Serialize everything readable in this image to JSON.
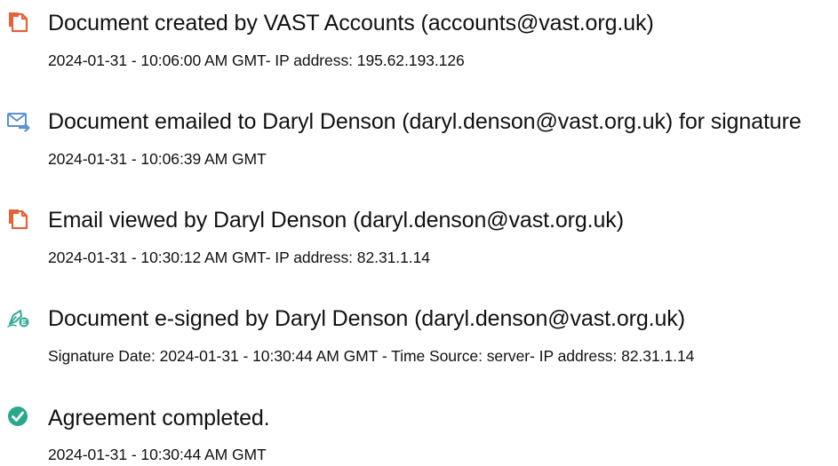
{
  "colors": {
    "document_icon": "#e0643c",
    "email_icon": "#5b92cf",
    "signed_icon": "#3aa897",
    "completed_icon": "#2aa88d",
    "text": "#111111"
  },
  "events": [
    {
      "icon": "document-icon",
      "title": "Document created by VAST Accounts (accounts@vast.org.uk)",
      "detail": "2024-01-31 - 10:06:00 AM GMT- IP address: 195.62.193.126"
    },
    {
      "icon": "email-send-icon",
      "title": "Document emailed to Daryl Denson (daryl.denson@vast.org.uk) for signature",
      "detail": "2024-01-31 - 10:06:39 AM GMT"
    },
    {
      "icon": "document-icon",
      "title": "Email viewed by Daryl Denson (daryl.denson@vast.org.uk)",
      "detail": "2024-01-31 - 10:30:12 AM GMT- IP address: 82.31.1.14"
    },
    {
      "icon": "pen-signature-icon",
      "title": "Document e-signed by Daryl Denson (daryl.denson@vast.org.uk)",
      "detail": "Signature Date: 2024-01-31 - 10:30:44 AM GMT - Time Source: server- IP address: 82.31.1.14"
    },
    {
      "icon": "check-circle-icon",
      "title": "Agreement completed.",
      "detail": "2024-01-31 - 10:30:44 AM GMT"
    }
  ]
}
